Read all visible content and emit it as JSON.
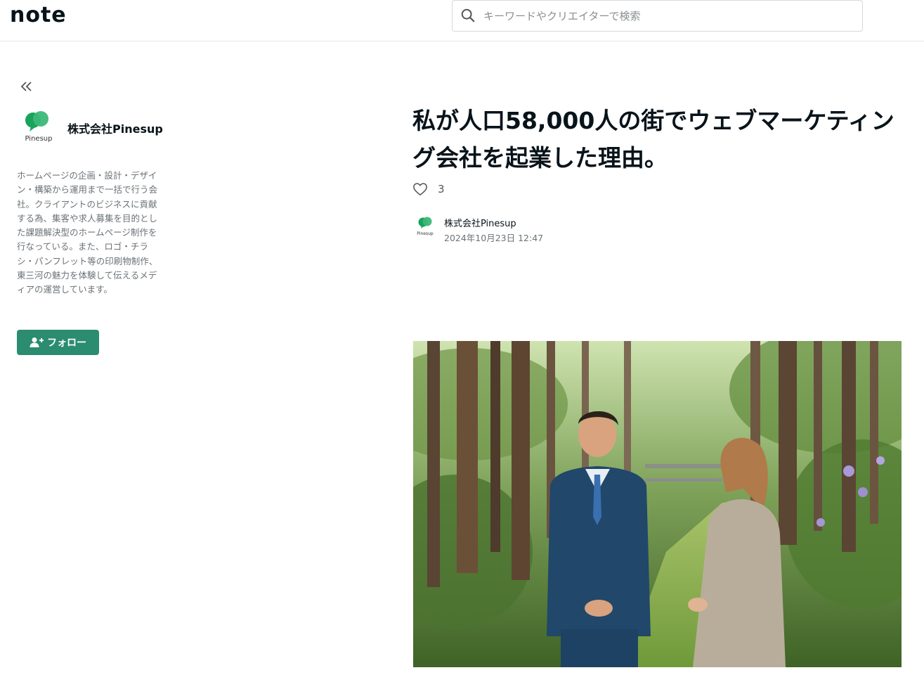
{
  "header": {
    "logo": "note",
    "search_placeholder": "キーワードやクリエイターで検索"
  },
  "sidebar": {
    "creator_name": "株式会社Pinesup",
    "avatar_label": "Pinesup",
    "bio": "ホームページの企画・設計・デザイン・構築から運用まで一括で行う会社。クライアントのビジネスに貢献する為、集客や求人募集を目的とした課題解決型のホームページ制作を行なっている。また、ロゴ・チラシ・パンフレット等の印刷物制作、東三河の魅力を体験して伝えるメディアの運営しています。",
    "follow_label": "フォロー"
  },
  "article": {
    "title": "私が人口58,000人の街でウェブマーケティング会社を起業した理由。",
    "like_count": "3",
    "author_name": "株式会社Pinesup",
    "author_avatar_label": "Pinesup",
    "date": "2024年10月23日 12:47"
  },
  "colors": {
    "brand_green": "#2b8c6f",
    "text": "#08131a",
    "muted": "#6b7277"
  }
}
